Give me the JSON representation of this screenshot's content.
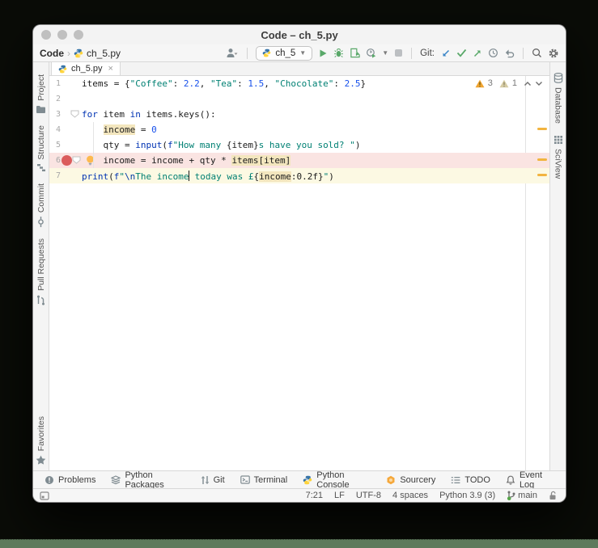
{
  "title": "Code – ch_5.py",
  "toolbar": {
    "project": "Code",
    "crumb_sep": "›",
    "file": "ch_5.py",
    "run_config": "ch_5",
    "git_label": "Git:"
  },
  "tab_label": "ch_5.py",
  "tab_close": "×",
  "editor": {
    "warnings": "3",
    "weak_warnings": "1",
    "lines": [
      {
        "n": "1",
        "t": [
          [
            "items = {",
            "p"
          ],
          [
            "\"Coffee\"",
            "s"
          ],
          [
            ": ",
            "p"
          ],
          [
            "2.2",
            "n"
          ],
          [
            ", ",
            "p"
          ],
          [
            "\"Tea\"",
            "s"
          ],
          [
            ": ",
            "p"
          ],
          [
            "1.5",
            "n"
          ],
          [
            ", ",
            "p"
          ],
          [
            "\"Chocolate\"",
            "s"
          ],
          [
            ": ",
            "p"
          ],
          [
            "2.5",
            "n"
          ],
          [
            "}",
            "p"
          ]
        ]
      },
      {
        "n": "2",
        "t": []
      },
      {
        "n": "3",
        "t": [
          [
            "for",
            "k"
          ],
          [
            " item ",
            "p"
          ],
          [
            "in",
            "k"
          ],
          [
            " items.keys():",
            "p"
          ]
        ],
        "fold": true
      },
      {
        "n": "4",
        "t": [
          [
            "    ",
            "p"
          ],
          [
            "income",
            "h"
          ],
          [
            " = ",
            "p"
          ],
          [
            "0",
            "n"
          ]
        ]
      },
      {
        "n": "5",
        "t": [
          [
            "    qty = ",
            "p"
          ],
          [
            "input",
            "k"
          ],
          [
            "(",
            "p"
          ],
          [
            "f",
            "k"
          ],
          [
            "\"How many ",
            "s"
          ],
          [
            "{item}",
            "p"
          ],
          [
            "s have you sold? \"",
            "s"
          ],
          [
            ")",
            "p"
          ]
        ]
      },
      {
        "n": "6",
        "t": [
          [
            "    income = income + qty * ",
            "p"
          ],
          [
            "items[item]",
            "h"
          ]
        ],
        "breakpoint": true,
        "bulb": true,
        "bg": "pink"
      },
      {
        "n": "7",
        "t": [
          [
            "print",
            "k"
          ],
          [
            "(",
            "p"
          ],
          [
            "f",
            "k"
          ],
          [
            "\"",
            "s"
          ],
          [
            "\\n",
            "e"
          ],
          [
            "The income",
            "s"
          ],
          [
            "",
            "cursor"
          ],
          [
            " today was £",
            "s"
          ],
          [
            "{",
            "p"
          ],
          [
            "income",
            "h"
          ],
          [
            ":0.2f",
            "p"
          ],
          [
            "}",
            "p"
          ],
          [
            "\"",
            "s"
          ],
          [
            ")",
            "p"
          ]
        ],
        "bg": "yellow"
      }
    ],
    "error_stripe_rows": [
      4,
      6,
      7
    ]
  },
  "left_stripe": {
    "top": [
      {
        "label": "Project",
        "icon": "folder-icon"
      },
      {
        "label": "Structure",
        "icon": "structure-icon"
      },
      {
        "label": "Commit",
        "icon": "commit-icon"
      },
      {
        "label": "Pull Requests",
        "icon": "pull-requests-icon"
      }
    ],
    "bottom": [
      {
        "label": "Favorites",
        "icon": "star-icon"
      }
    ]
  },
  "right_stripe": [
    {
      "label": "Database",
      "icon": "database-icon"
    },
    {
      "label": "SciView",
      "icon": "sciview-icon"
    }
  ],
  "bottom_tools": {
    "left": [
      {
        "label": "Problems",
        "icon": "problems-icon"
      },
      {
        "label": "Python Packages",
        "icon": "packages-icon"
      },
      {
        "label": "Git",
        "icon": "git-icon"
      },
      {
        "label": "Terminal",
        "icon": "terminal-icon"
      },
      {
        "label": "Python Console",
        "icon": "python-console-icon"
      },
      {
        "label": "Sourcery",
        "icon": "sourcery-icon"
      },
      {
        "label": "TODO",
        "icon": "todo-icon"
      }
    ],
    "right": [
      {
        "label": "Event Log",
        "icon": "event-log-icon"
      }
    ]
  },
  "status": {
    "items": [
      "7:21",
      "LF",
      "UTF-8",
      "4 spaces",
      "Python 3.9 (3)"
    ],
    "branch": "main"
  },
  "colors": {
    "keyword": "#0033B3",
    "string": "#008073",
    "number": "#1750EB",
    "escape": "#0037A6",
    "identifier_highlight": "#F3E6BE",
    "breakpoint_line_bg": "#FAE4E2",
    "current_line_bg": "#FCF9E3",
    "breakpoint_red": "#DB5C5C",
    "warning_orange": "#F0A431",
    "weak_warning": "#D6CCA4",
    "run_green": "#59A869",
    "git_blue": "#3A85C7",
    "desktop_strip": "#5E7A5C"
  }
}
